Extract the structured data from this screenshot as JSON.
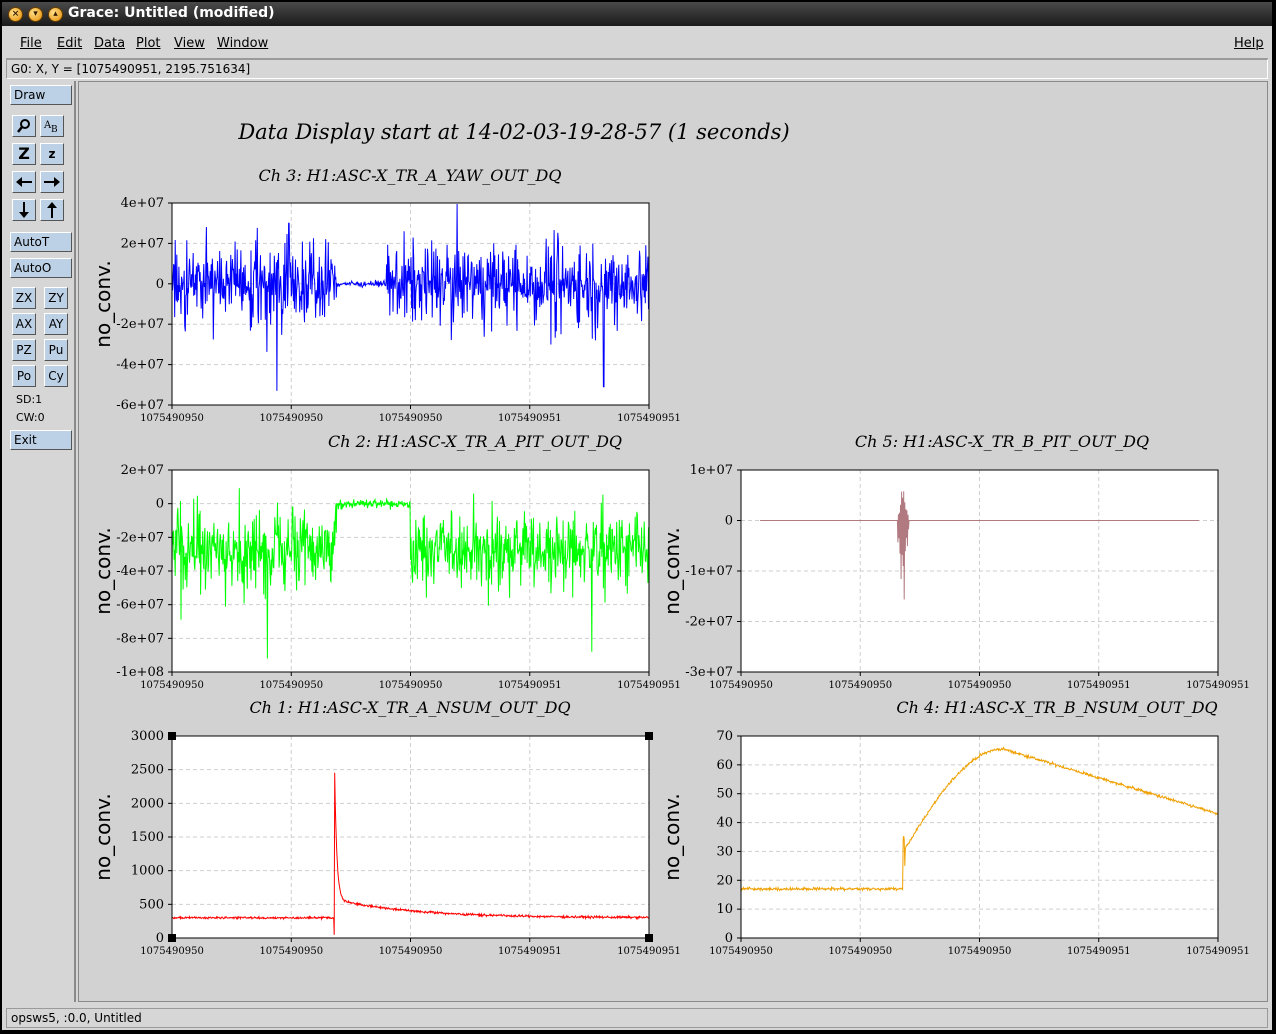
{
  "window": {
    "title": "Grace: Untitled (modified)",
    "locator": "G0: X, Y = [1075490951, 2195.751634]",
    "status": "opsws5, :0.0, Untitled"
  },
  "menu": {
    "file": "File",
    "edit": "Edit",
    "data": "Data",
    "plot": "Plot",
    "view": "View",
    "window": "Window",
    "help": "Help"
  },
  "toolbar": {
    "draw": "Draw",
    "zoom_big": "Z",
    "zoom_small": "z",
    "autot": "AutoT",
    "autoo": "AutoO",
    "zx": "ZX",
    "zy": "ZY",
    "ax": "AX",
    "ay": "AY",
    "pz": "PZ",
    "pu": "Pu",
    "po": "Po",
    "cy": "Cy",
    "sd": "SD:1",
    "cw": "CW:0",
    "exit": "Exit",
    "icons": [
      "magnifier-icon",
      "text-icon",
      "zoom-in-icon",
      "zoom-out-icon",
      "arrow-left-icon",
      "arrow-right-icon",
      "arrow-down-icon",
      "arrow-up-icon"
    ]
  },
  "plot_title": "Data Display start at 14-02-03-19-28-57 (1 seconds)",
  "chart_data": [
    {
      "type": "line",
      "title": "Ch 3: H1:ASC-X_TR_A_YAW_OUT_DQ",
      "ylabel": "no_conv.",
      "color": "#0000ff",
      "yticks": [
        "4e+07",
        "2e+07",
        "0",
        "-2e+07",
        "-4e+07",
        "-6e+07"
      ],
      "ylim": [
        -60000000,
        40000000
      ],
      "xticks": [
        "1075490950",
        "1075490950",
        "1075490950",
        "1075490951",
        "1075490951"
      ],
      "grid": true,
      "profile": {
        "kind": "noise",
        "amp": 28000000,
        "center": 0,
        "quiet_start": 0.345,
        "quiet_end": 0.45,
        "quiet_amp": 1200000,
        "spikes": [
          [
            0.22,
            -53000000
          ],
          [
            0.905,
            -51000000
          ],
          [
            0.245,
            30000000
          ]
        ]
      }
    },
    {
      "type": "line",
      "title": "Ch 2: H1:ASC-X_TR_A_PIT_OUT_DQ",
      "ylabel": "no_conv.",
      "color": "#00ff00",
      "yticks": [
        "2e+07",
        "0",
        "-2e+07",
        "-4e+07",
        "-6e+07",
        "-8e+07",
        "-1e+08"
      ],
      "ylim": [
        -100000000,
        20000000
      ],
      "xticks": [
        "1075490950",
        "1075490950",
        "1075490950",
        "1075490951",
        "1075490951"
      ],
      "grid": true,
      "profile": {
        "kind": "noise",
        "amp": 32000000,
        "center": -28000000,
        "quiet_start": 0.345,
        "quiet_end": 0.5,
        "quiet_amp": 2500000,
        "quiet_center": 0,
        "spikes": [
          [
            0.2,
            -92000000
          ],
          [
            0.88,
            -88000000
          ]
        ]
      }
    },
    {
      "type": "line",
      "title": "Ch 5: H1:ASC-X_TR_B_PIT_OUT_DQ",
      "ylabel": "no_conv.",
      "color": "#b07a80",
      "yticks": [
        "1e+07",
        "0",
        "-1e+07",
        "-2e+07",
        "-3e+07"
      ],
      "ylim": [
        -30000000,
        10000000
      ],
      "xticks": [
        "1075490950",
        "1075490950",
        "1075490950",
        "1075490951",
        "1075490951"
      ],
      "grid": true,
      "profile": {
        "kind": "burst",
        "x0": 0.04,
        "x1": 0.96,
        "at": 0.34,
        "up": 9500000,
        "down": -23000000
      }
    },
    {
      "type": "line",
      "title": "Ch 1: H1:ASC-X_TR_A_NSUM_OUT_DQ",
      "ylabel": "no_conv.",
      "color": "#ff0000",
      "yticks": [
        "3000",
        "2500",
        "2000",
        "1500",
        "1000",
        "500",
        "0"
      ],
      "ylim": [
        -300,
        3000
      ],
      "xticks": [
        "1075490950",
        "1075490950",
        "1075490950",
        "1075490951",
        "1075490951"
      ],
      "grid": true,
      "profile": {
        "kind": "decay",
        "base": 30,
        "at": 0.34,
        "peak": 2650,
        "tail": 300,
        "floor": 30,
        "noise": 18
      }
    },
    {
      "type": "line",
      "title": "Ch 4: H1:ASC-X_TR_B_NSUM_OUT_DQ",
      "ylabel": "no_conv.",
      "color": "#f0a000",
      "yticks": [
        "70",
        "60",
        "50",
        "40",
        "30",
        "20",
        "10",
        "0"
      ],
      "ylim": [
        0,
        70
      ],
      "xticks": [
        "1075490950",
        "1075490950",
        "1075490950",
        "1075490951",
        "1075490951"
      ],
      "grid": true,
      "profile": {
        "kind": "rise",
        "base": 17,
        "at": 0.34,
        "jump": 30,
        "peakx": 0.55,
        "peak": 65.5,
        "end": 43,
        "noise": 0.5
      }
    }
  ]
}
